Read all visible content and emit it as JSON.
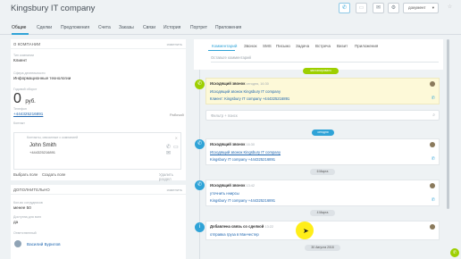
{
  "header": {
    "title": "Kingsbury IT company",
    "title_icons": [
      "pencil-icon",
      "star-icon"
    ],
    "doc_button": "документ",
    "accent": "#2fa3d7"
  },
  "tabs": [
    {
      "label": "Общие",
      "active": true
    },
    {
      "label": "Сделки"
    },
    {
      "label": "Предложения"
    },
    {
      "label": "Счета"
    },
    {
      "label": "Заказы"
    },
    {
      "label": "Связи"
    },
    {
      "label": "История"
    },
    {
      "label": "Портрет"
    },
    {
      "label": "Приложения"
    }
  ],
  "about": {
    "title": "О КОМПАНИИ",
    "change": "изменить",
    "company_type_label": "Тип компании",
    "company_type": "Клиент",
    "industry_label": "Сфера деятельности",
    "industry": "Информационные технологии",
    "revenue_label": "Годовой оборот",
    "revenue_amount": "0",
    "revenue_currency": "руб.",
    "phone_label": "Телефон",
    "phone": "+444325216891",
    "phone_type": "Рабочий",
    "contacts_label": "Контакт",
    "contact_box_label": "Контакты, связанные с компанией",
    "contact_name": "John Smith",
    "contact_phone": "+444325216891",
    "choose_link": "Выбрать поле",
    "create_link": "Создать поле",
    "delete_section": "Удалить раздел"
  },
  "additional": {
    "title": "ДОПОЛНИТЕЛЬНО",
    "change": "изменить",
    "employees_label": "Кол-во сотрудников",
    "employees": "менее 50",
    "available_label": "Доступна для всех",
    "available": "да",
    "responsible_label": "Ответственный",
    "responsible": "Василий Бурилов"
  },
  "timeline": {
    "tabs": [
      "Комментарий",
      "Звонок",
      "SMS",
      "Письмо",
      "Задача",
      "Встреча",
      "Визит",
      "Приложения"
    ],
    "comment_placeholder": "Оставьте комментарий",
    "planned_pill": "запланировано",
    "today_pill": "сегодня",
    "search_placeholder": "Фильтр + поиск",
    "planned_card": {
      "title": "Исходящий звонок",
      "time": "сегодня, 16:30",
      "line1": "Исходящий звонок Kingsbury IT company",
      "line2": "Клиент: Kingsbury IT company +444325216891"
    },
    "card1": {
      "title": "Исходящий звонок",
      "time": "16:30",
      "line1": "Исходящий звонок Kingsbury IT company",
      "line2": "Kingsbury IT company +444325216891"
    },
    "date1": "6 Марта",
    "card2": {
      "title": "Исходящий звонок",
      "time": "13:42",
      "line1": "уточнить ннирсы",
      "line2": "Kingsbury IT company +444325216891"
    },
    "date2": "4 Марта",
    "card3": {
      "title": "Добавлена связь со сделкой",
      "time": "13:22",
      "line1": "отправка груза в Манчестер"
    },
    "date3": "30 Августа 2018"
  }
}
